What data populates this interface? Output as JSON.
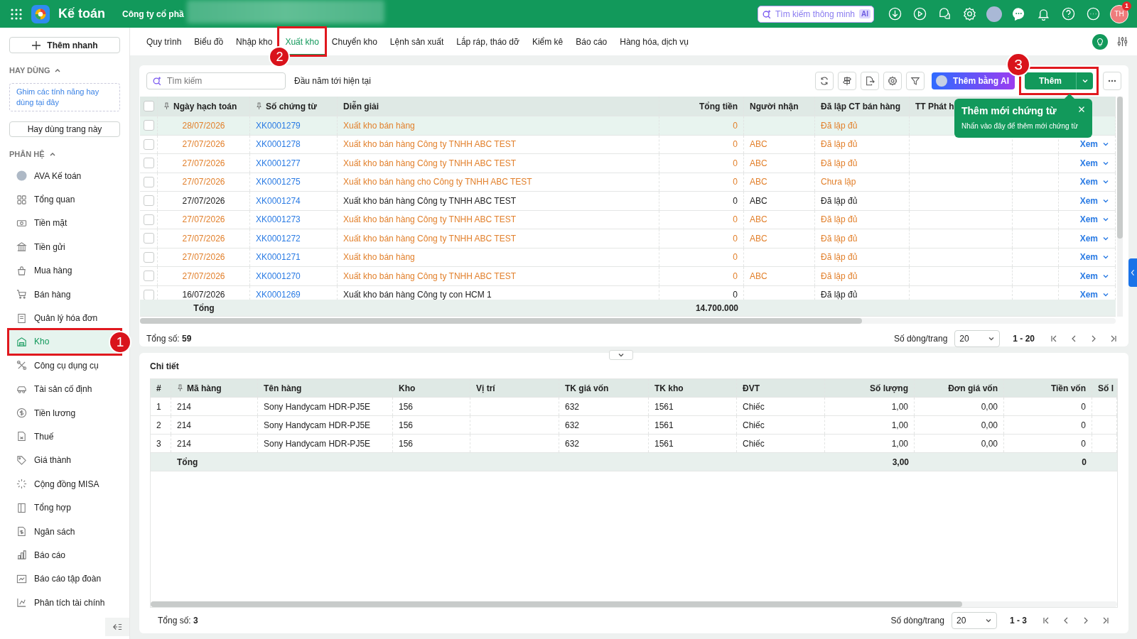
{
  "topbar": {
    "app_name": "Kế toán",
    "company": "Công ty cổ phầ",
    "search": {
      "placeholder": "Tìm kiếm thông minh",
      "badge": "AI"
    },
    "user": {
      "initials": "TH",
      "notifications": "1"
    }
  },
  "sidebar": {
    "quick_add": "Thêm nhanh",
    "favorites": {
      "title": "HAY DÙNG",
      "expanded": true,
      "hint": "Ghim các tính năng hay dùng tại đây",
      "button": "Hay dùng trang này"
    },
    "modules": {
      "title": "PHÂN HỆ",
      "expanded": true,
      "items": [
        {
          "label": "AVA Kế toán",
          "selected": false
        },
        {
          "label": "Tổng quan",
          "selected": false
        },
        {
          "label": "Tiền mặt",
          "selected": false
        },
        {
          "label": "Tiền gửi",
          "selected": false
        },
        {
          "label": "Mua hàng",
          "selected": false
        },
        {
          "label": "Bán hàng",
          "selected": false
        },
        {
          "label": "Quản lý hóa đơn",
          "selected": false
        },
        {
          "label": "Kho",
          "selected": true,
          "callout": "1"
        },
        {
          "label": "Công cụ dụng cụ",
          "selected": false
        },
        {
          "label": "Tài sản cố định",
          "selected": false
        },
        {
          "label": "Tiền lương",
          "selected": false
        },
        {
          "label": "Thuế",
          "selected": false
        },
        {
          "label": "Giá thành",
          "selected": false
        },
        {
          "label": "Cộng đồng MISA",
          "selected": false
        },
        {
          "label": "Tổng hợp",
          "selected": false
        },
        {
          "label": "Ngân sách",
          "selected": false
        },
        {
          "label": "Báo cáo",
          "selected": false
        },
        {
          "label": "Báo cáo tập đoàn",
          "selected": false
        },
        {
          "label": "Phân tích tài chính",
          "selected": false
        }
      ]
    }
  },
  "tabs": [
    {
      "label": "Quy trình",
      "selected": false
    },
    {
      "label": "Biểu đồ",
      "selected": false
    },
    {
      "label": "Nhập kho",
      "selected": false
    },
    {
      "label": "Xuất kho",
      "selected": true,
      "callout": "2"
    },
    {
      "label": "Chuyển kho",
      "selected": false
    },
    {
      "label": "Lệnh sản xuất",
      "selected": false
    },
    {
      "label": "Lắp ráp, tháo dỡ",
      "selected": false
    },
    {
      "label": "Kiểm kê",
      "selected": false
    },
    {
      "label": "Báo cáo",
      "selected": false
    },
    {
      "label": "Hàng hóa, dịch vụ",
      "selected": false
    }
  ],
  "toolbar": {
    "search": {
      "placeholder": "Tìm kiếm"
    },
    "period": "Đầu năm tới hiện tại",
    "ai_button": "Thêm bằng AI",
    "add_button": {
      "label": "Thêm",
      "callout": "3"
    }
  },
  "tooltip": {
    "title": "Thêm mới chứng từ",
    "text": "Nhấn vào đây để thêm mới chứng từ"
  },
  "table": {
    "select_all": false,
    "columns": [
      {
        "label": "Ngày hạch toán",
        "pinned": true
      },
      {
        "label": "Số chứng từ",
        "pinned": true
      },
      {
        "label": "Diễn giải",
        "pinned": false
      },
      {
        "label": "Tổng tiền",
        "pinned": false
      },
      {
        "label": "Người nhận",
        "pinned": false
      },
      {
        "label": "Đã lập CT bán hàng",
        "pinned": false
      },
      {
        "label": "TT Phát h",
        "pinned": false
      }
    ],
    "rows": [
      {
        "checked": false,
        "selected": true,
        "posted": false,
        "date": "28/07/2026",
        "number": "XK0001279",
        "description": "Xuất kho bán hàng",
        "amount": "0",
        "sales_voucher": "Đã lập đủ"
      },
      {
        "checked": false,
        "selected": false,
        "posted": false,
        "date": "27/07/2026",
        "number": "XK0001278",
        "description": "Xuất kho bán hàng Công ty TNHH ABC TEST",
        "amount": "0",
        "receiver": "ABC",
        "sales_voucher": "Đã lập đủ",
        "action": "Xem"
      },
      {
        "checked": false,
        "selected": false,
        "posted": false,
        "date": "27/07/2026",
        "number": "XK0001277",
        "description": "Xuất kho bán hàng Công ty TNHH ABC TEST",
        "amount": "0",
        "receiver": "ABC",
        "sales_voucher": "Đã lập đủ",
        "action": "Xem"
      },
      {
        "checked": false,
        "selected": false,
        "posted": false,
        "date": "27/07/2026",
        "number": "XK0001275",
        "description": "Xuất kho bán hàng cho Công ty TNHH ABC TEST",
        "amount": "0",
        "receiver": "ABC",
        "sales_voucher": "Chưa lập",
        "action": "Xem"
      },
      {
        "checked": false,
        "selected": false,
        "posted": true,
        "date": "27/07/2026",
        "number": "XK0001274",
        "description": "Xuất kho bán hàng Công ty TNHH ABC TEST",
        "amount": "0",
        "receiver": "ABC",
        "sales_voucher": "Đã lập đủ",
        "action": "Xem"
      },
      {
        "checked": false,
        "selected": false,
        "posted": false,
        "date": "27/07/2026",
        "number": "XK0001273",
        "description": "Xuất kho bán hàng Công ty TNHH ABC TEST",
        "amount": "0",
        "receiver": "ABC",
        "sales_voucher": "Đã lập đủ",
        "action": "Xem"
      },
      {
        "checked": false,
        "selected": false,
        "posted": false,
        "date": "27/07/2026",
        "number": "XK0001272",
        "description": "Xuất kho bán hàng Công ty TNHH ABC TEST",
        "amount": "0",
        "receiver": "ABC",
        "sales_voucher": "Đã lập đủ",
        "action": "Xem"
      },
      {
        "checked": false,
        "selected": false,
        "posted": false,
        "date": "27/07/2026",
        "number": "XK0001271",
        "description": "Xuất kho bán hàng",
        "amount": "0",
        "sales_voucher": "Đã lập đủ",
        "action": "Xem"
      },
      {
        "checked": false,
        "selected": false,
        "posted": false,
        "date": "27/07/2026",
        "number": "XK0001270",
        "description": "Xuất kho bán hàng Công ty TNHH ABC TEST",
        "amount": "0",
        "receiver": "ABC",
        "sales_voucher": "Đã lập đủ",
        "action": "Xem"
      },
      {
        "checked": false,
        "selected": false,
        "posted": true,
        "date": "16/07/2026",
        "number": "XK0001269",
        "description": "Xuất kho bán hàng Công ty con HCM 1",
        "amount": "0",
        "sales_voucher": "Đã lập đủ",
        "action": "Xem"
      }
    ],
    "total_label": "Tổng",
    "total_amount": "14.700.000"
  },
  "pagination": {
    "total": "Tổng số: **59**",
    "page_size_label": "Số dòng/trang",
    "page_size": "20",
    "range": "1 - 20"
  },
  "detail": {
    "title": "Chi tiết",
    "columns": [
      {
        "label": "#",
        "pinned": false
      },
      {
        "label": "Mã hàng",
        "pinned": true
      },
      {
        "label": "Tên hàng",
        "pinned": false
      },
      {
        "label": "Kho",
        "pinned": false
      },
      {
        "label": "Vị trí",
        "pinned": false
      },
      {
        "label": "TK giá vốn",
        "pinned": false
      },
      {
        "label": "TK kho",
        "pinned": false
      },
      {
        "label": "ĐVT",
        "pinned": false
      },
      {
        "label": "Số lượng",
        "pinned": false
      },
      {
        "label": "Đơn giá vốn",
        "pinned": false
      },
      {
        "label": "Tiền vốn",
        "pinned": false
      },
      {
        "label": "Số l",
        "pinned": false
      }
    ],
    "rows": [
      {
        "no": "1",
        "code": "214",
        "name": "Sony Handycam HDR-PJ5E",
        "warehouse": "156",
        "cogs_account": "632",
        "stock_account": "1561",
        "unit": "Chiếc",
        "quantity": "1,00",
        "unit_cost": "0,00",
        "cost": "0"
      },
      {
        "no": "2",
        "code": "214",
        "name": "Sony Handycam HDR-PJ5E",
        "warehouse": "156",
        "cogs_account": "632",
        "stock_account": "1561",
        "unit": "Chiếc",
        "quantity": "1,00",
        "unit_cost": "0,00",
        "cost": "0"
      },
      {
        "no": "3",
        "code": "214",
        "name": "Sony Handycam HDR-PJ5E",
        "warehouse": "156",
        "cogs_account": "632",
        "stock_account": "1561",
        "unit": "Chiếc",
        "quantity": "1,00",
        "unit_cost": "0,00",
        "cost": "0"
      }
    ],
    "total_label": "Tổng",
    "total_quantity": "3,00",
    "total_cost": "0",
    "pagination": {
      "total": "Tổng số: **3**",
      "page_size_label": "Số dòng/trang",
      "page_size": "20",
      "range": "1 - 3"
    }
  }
}
